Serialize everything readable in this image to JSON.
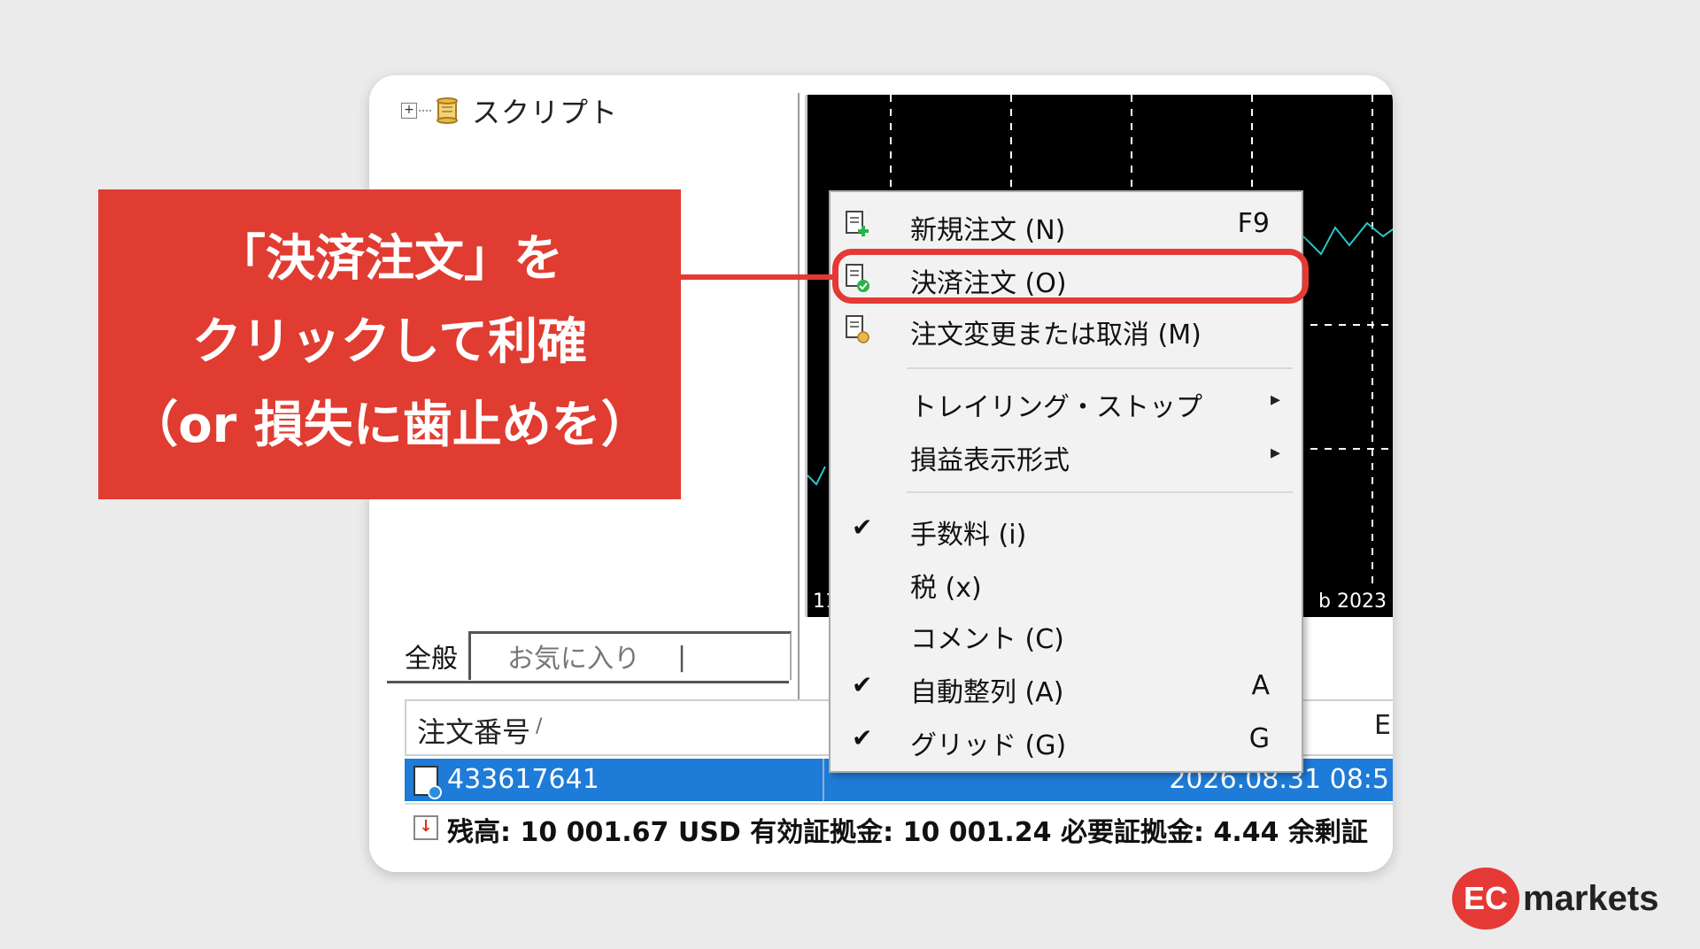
{
  "callout": {
    "line1": "「決済注文」を",
    "line2": "クリックして利確",
    "line3": "（or 損失に歯止めを）"
  },
  "navigator": {
    "scripts_label": "スクリプト",
    "expander": "+",
    "icon": "scroll-icon"
  },
  "chart": {
    "date_left": "11",
    "date_right": "b 2023",
    "background": "#000000",
    "line_color": "#2ec4c4"
  },
  "tabs": {
    "all": "全般",
    "favorites": "お気に入り",
    "separator": "|"
  },
  "table": {
    "header_order": "注文番号",
    "header_sort": "/",
    "header_right": "E",
    "row_id": "433617641",
    "row_date": "2026.08.31 08:5",
    "balance_text": "残高: 10 001.67 USD  有効証拠金: 10 001.24  必要証拠金: 4.44  余剰証"
  },
  "context_menu": {
    "items": [
      {
        "label": "新規注文 (N)",
        "shortcut": "F9",
        "icon": "new-order-icon"
      },
      {
        "label": "決済注文 (O)",
        "shortcut": "",
        "icon": "close-order-icon",
        "highlighted": true
      },
      {
        "label": "注文変更または取消 (M)",
        "shortcut": "",
        "icon": "modify-order-icon"
      },
      {
        "label": "トレイリング・ストップ",
        "submenu": true
      },
      {
        "label": "損益表示形式",
        "submenu": true
      },
      {
        "label": "手数料 (i)",
        "checked": true
      },
      {
        "label": "税 (x)",
        "checked": false
      },
      {
        "label": "コメント (C)",
        "checked": false
      },
      {
        "label": "自動整列 (A)",
        "shortcut": "A",
        "checked": true
      },
      {
        "label": "グリッド (G)",
        "shortcut": "G",
        "checked": true
      }
    ],
    "submenu_arrow": "▸",
    "check_mark": "✔"
  },
  "logo": {
    "mark": "EC",
    "text": "markets"
  },
  "colors": {
    "accent": "#e53935",
    "callout_bg": "#e03c31",
    "selection": "#1e7bd8"
  }
}
